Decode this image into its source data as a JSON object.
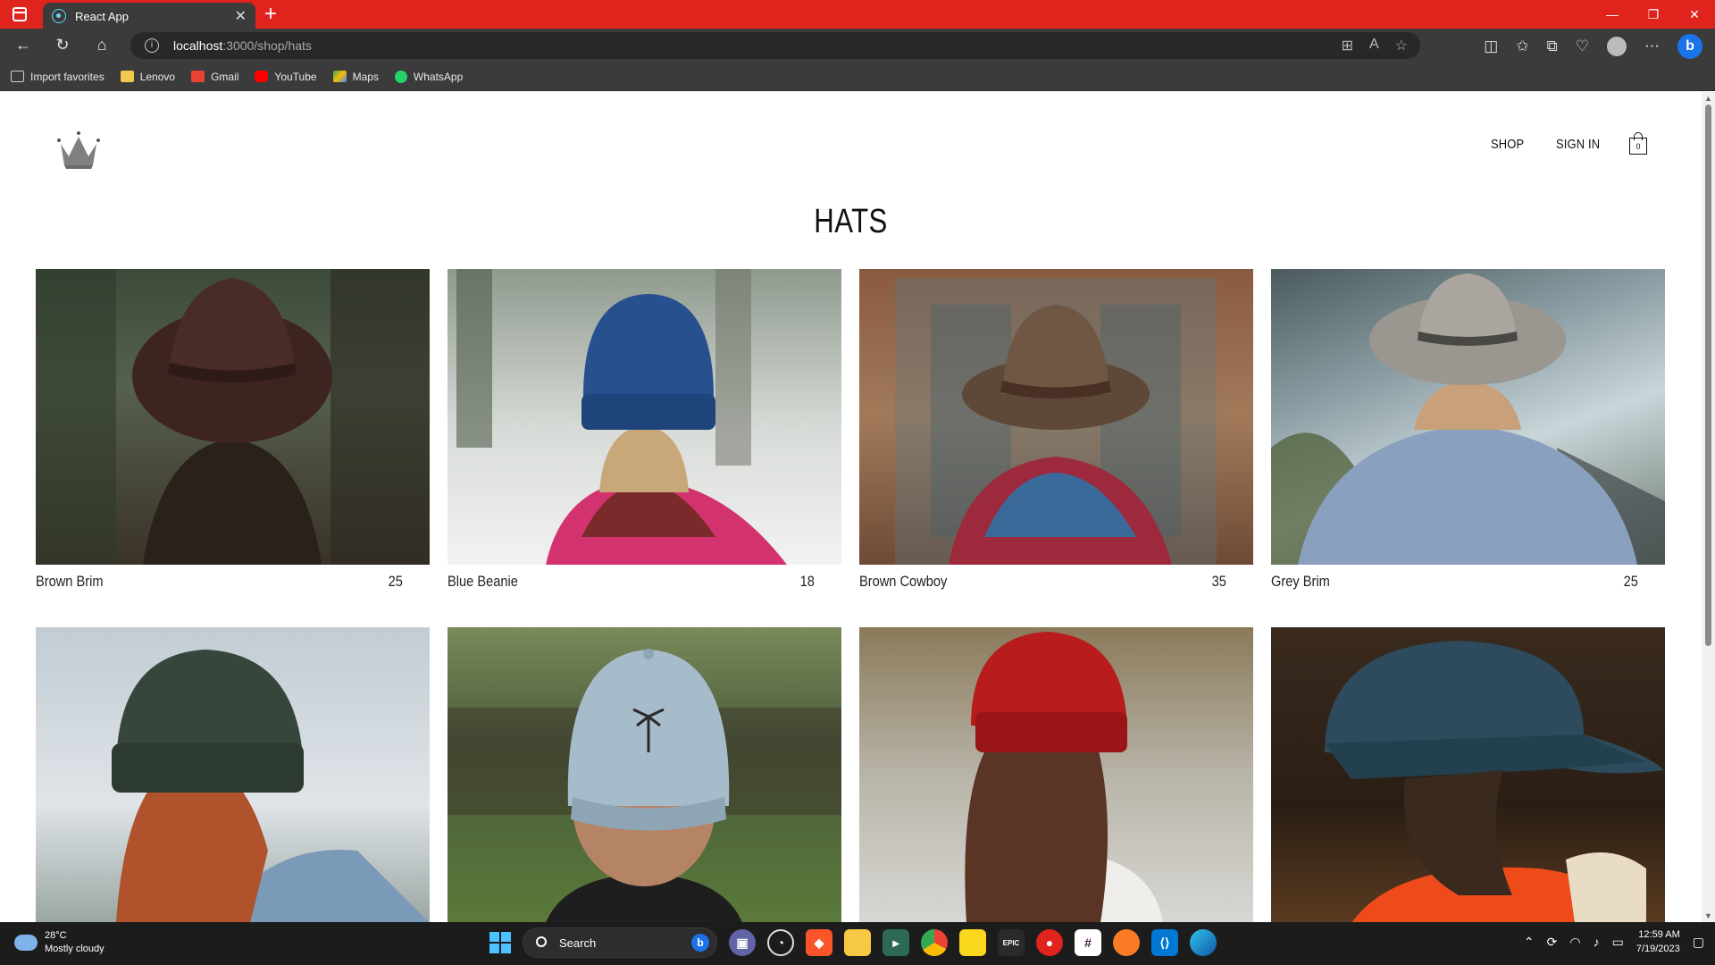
{
  "browser": {
    "tab_title": "React App",
    "tab_close": "✕",
    "new_tab": "+",
    "url_host": "localhost",
    "url_rest": ":3000/shop/hats",
    "favorites": [
      {
        "label": "Import favorites",
        "icon": "import-icon",
        "color": "#cfcfcf"
      },
      {
        "label": "Lenovo",
        "icon": "folder-icon",
        "color": "#f2c94c"
      },
      {
        "label": "Gmail",
        "icon": "gmail-icon",
        "color": "#ea4335"
      },
      {
        "label": "YouTube",
        "icon": "youtube-icon",
        "color": "#ff0000"
      },
      {
        "label": "Maps",
        "icon": "maps-icon",
        "color": "#34a853"
      },
      {
        "label": "WhatsApp",
        "icon": "whatsapp-icon",
        "color": "#25d366"
      }
    ]
  },
  "header": {
    "nav": {
      "shop": "SHOP",
      "sign_in": "SIGN IN"
    },
    "cart_count": "0"
  },
  "page": {
    "title": "HATS",
    "products": [
      {
        "name": "Brown Brim",
        "price": "25"
      },
      {
        "name": "Blue Beanie",
        "price": "18"
      },
      {
        "name": "Brown Cowboy",
        "price": "35"
      },
      {
        "name": "Grey Brim",
        "price": "25"
      },
      {
        "name": "",
        "price": ""
      },
      {
        "name": "",
        "price": ""
      },
      {
        "name": "",
        "price": ""
      },
      {
        "name": "",
        "price": ""
      }
    ]
  },
  "taskbar": {
    "weather_temp": "28°C",
    "weather_desc": "Mostly cloudy",
    "search_label": "Search",
    "time": "12:59 AM",
    "date": "7/19/2023"
  },
  "colors": {
    "title_bar": "#e0231c",
    "chrome_dark": "#3b3b3b",
    "accent": "#4cc2ff"
  }
}
